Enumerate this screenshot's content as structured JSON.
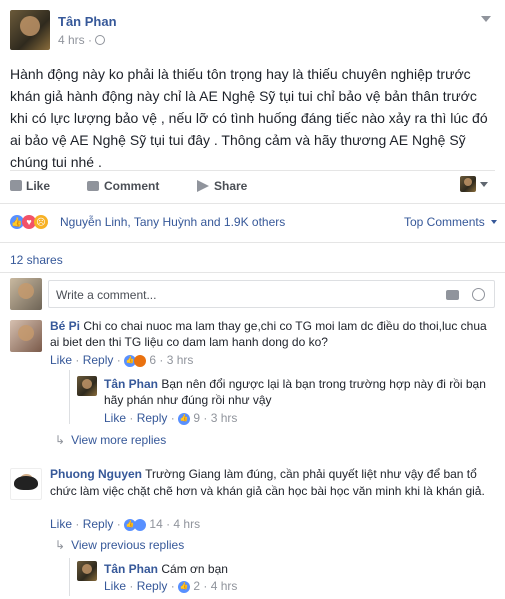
{
  "post": {
    "author": "Tân Phan",
    "time": "4 hrs",
    "privacy_icon": "globe-icon",
    "body": "Hành động này ko phải là thiếu tôn trọng hay là thiếu chuyên nghiệp trước khán giả hành động này chỉ là AE Nghệ Sỹ tụi tui chỉ bảo vệ bản thân trước khi có lực lượng bảo vệ , nếu lỡ có tình huống đáng tiếc nào xảy ra thì lúc đó ai bảo vệ AE Nghệ Sỹ tụi tui đây . Thông cảm và hãy thương AE Nghệ Sỹ chúng tui nhé ."
  },
  "actions": {
    "like": "Like",
    "comment": "Comment",
    "share": "Share"
  },
  "reactions": {
    "summary": "Nguyễn Linh, Tany Huỳnh and 1.9K others",
    "sort": "Top Comments"
  },
  "shares": "12 shares",
  "composer": {
    "placeholder": "Write a comment..."
  },
  "comments": [
    {
      "author": "Bé Pi",
      "text": "Chi co chai nuoc ma lam thay ge,chi co TG moi lam dc điều do thoi,luc chua ai biet den thi TG liệu co dam lam hanh dong do ko?",
      "like": "Like",
      "reply": "Reply",
      "count": "6",
      "time": "3 hrs",
      "replies": [
        {
          "author": "Tân Phan",
          "text": "Bạn nên đổi ngược lại là bạn trong trường hợp này đi rồi bạn hãy phán như đúng rồi như vậy",
          "like": "Like",
          "reply": "Reply",
          "count": "9",
          "time": "3 hrs"
        }
      ],
      "more": "View more replies"
    },
    {
      "author": "Phuong Nguyen",
      "text": "Trường Giang làm đúng, cần phải quyết liệt như vậy để ban tổ chức làm việc chặt chẽ hơn và khán giả cần học bài học văn minh khi là khán giả.",
      "like": "Like",
      "reply": "Reply",
      "count": "14",
      "time": "4 hrs",
      "previous": "View previous replies",
      "replies": [
        {
          "author": "Tân Phan",
          "text": "Cám ơn bạn",
          "like": "Like",
          "reply": "Reply",
          "count": "2",
          "time": "4 hrs"
        }
      ]
    }
  ]
}
